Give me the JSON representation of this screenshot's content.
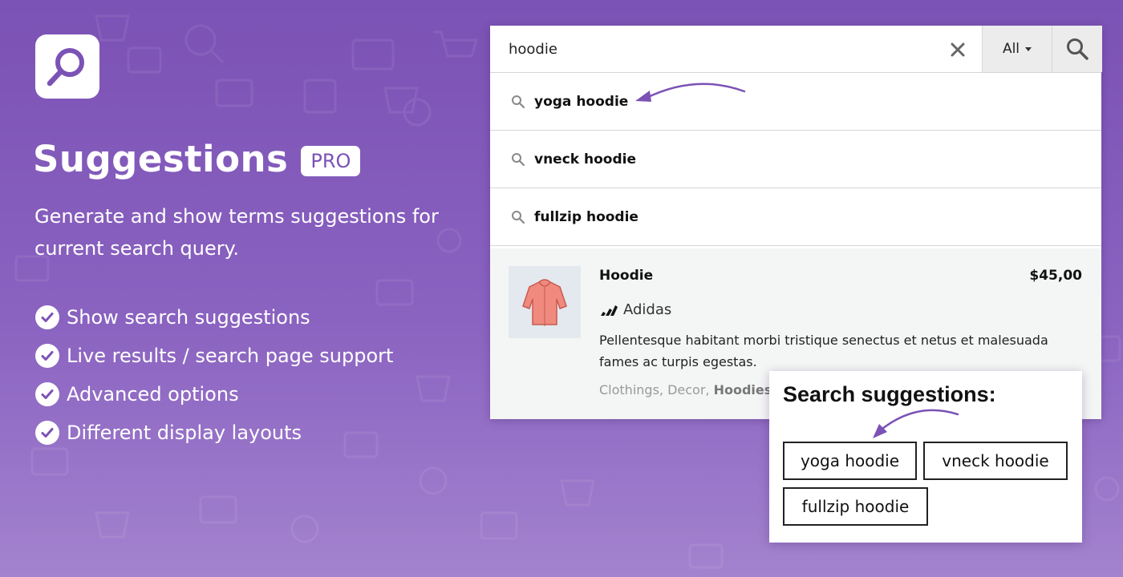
{
  "hero": {
    "title": "Suggestions",
    "badge": "PRO",
    "subtitle": "Generate and show terms suggestions for current search query.",
    "features": [
      "Show search suggestions",
      "Live results / search page support",
      "Advanced options",
      "Different display layouts"
    ]
  },
  "search": {
    "query": "hoodie",
    "category": "All"
  },
  "suggestions": [
    {
      "label": "yoga hoodie"
    },
    {
      "label": "vneck hoodie"
    },
    {
      "label": "fullzip hoodie"
    }
  ],
  "product": {
    "name": "Hoodie",
    "price": "$45,00",
    "brand": "Adidas",
    "description": "Pellentesque habitant morbi tristique senectus et netus et malesuada fames ac turpis egestas.",
    "categories_prefix": "Clothings, Decor, ",
    "categories_highlight": "Hoodies"
  },
  "suggestion_card": {
    "title": "Search suggestions:",
    "chips": [
      "yoga hoodie",
      "vneck hoodie",
      "fullzip hoodie"
    ]
  },
  "colors": {
    "accent": "#7b52b5",
    "arrow": "#7b52b5"
  }
}
